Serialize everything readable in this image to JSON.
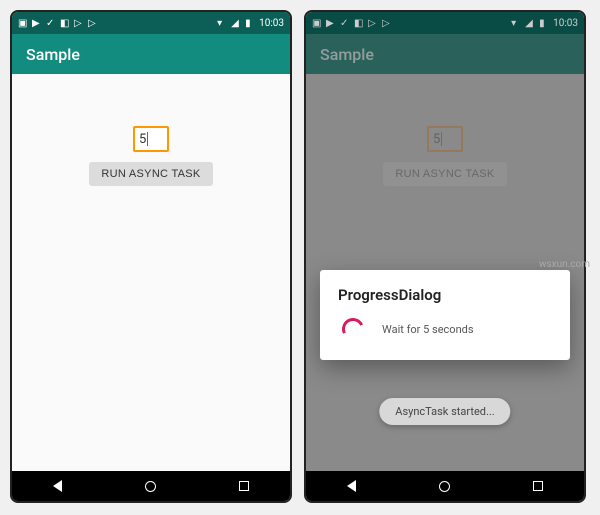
{
  "statusbar": {
    "time": "10:03",
    "signal_icon": "signal",
    "wifi_icon": "wifi",
    "battery_icon": "battery"
  },
  "appbar": {
    "title": "Sample"
  },
  "screen1": {
    "input_value": "5",
    "button_label": "RUN ASYNC TASK"
  },
  "screen2": {
    "input_value": "5",
    "button_label": "RUN ASYNC TASK",
    "dialog": {
      "title": "ProgressDialog",
      "message": "Wait for 5 seconds"
    },
    "toast": "AsyncTask started..."
  },
  "nav": {
    "back": "back",
    "home": "home",
    "recent": "recent"
  },
  "watermark": "wsxun.com"
}
